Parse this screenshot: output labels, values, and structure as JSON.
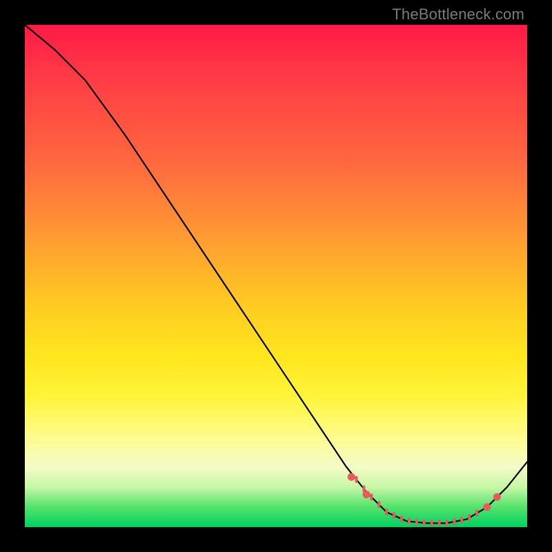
{
  "watermark": "TheBottleneck.com",
  "chart_data": {
    "type": "line",
    "title": "",
    "xlabel": "",
    "ylabel": "",
    "xlim": [
      0,
      100
    ],
    "ylim": [
      0,
      100
    ],
    "grid": false,
    "legend": false,
    "curve_points": [
      {
        "x": 0,
        "y": 100
      },
      {
        "x": 6,
        "y": 95
      },
      {
        "x": 12,
        "y": 89
      },
      {
        "x": 20,
        "y": 78
      },
      {
        "x": 30,
        "y": 63
      },
      {
        "x": 40,
        "y": 48
      },
      {
        "x": 50,
        "y": 33
      },
      {
        "x": 58,
        "y": 21
      },
      {
        "x": 64,
        "y": 12
      },
      {
        "x": 68,
        "y": 7
      },
      {
        "x": 72,
        "y": 3
      },
      {
        "x": 76,
        "y": 1.2
      },
      {
        "x": 80,
        "y": 0.8
      },
      {
        "x": 84,
        "y": 0.8
      },
      {
        "x": 88,
        "y": 1.6
      },
      {
        "x": 92,
        "y": 4
      },
      {
        "x": 96,
        "y": 8
      },
      {
        "x": 100,
        "y": 13
      }
    ],
    "highlight_ticks_x": [
      66,
      67.5,
      69,
      70.5,
      72,
      73.5,
      75,
      76.5,
      78,
      79.5,
      81,
      82.5,
      84,
      85.5,
      87,
      88.5,
      90
    ],
    "highlight_dots": [
      {
        "x": 65,
        "y": 10
      },
      {
        "x": 68,
        "y": 6.5
      },
      {
        "x": 92,
        "y": 4
      },
      {
        "x": 94,
        "y": 6
      }
    ]
  }
}
